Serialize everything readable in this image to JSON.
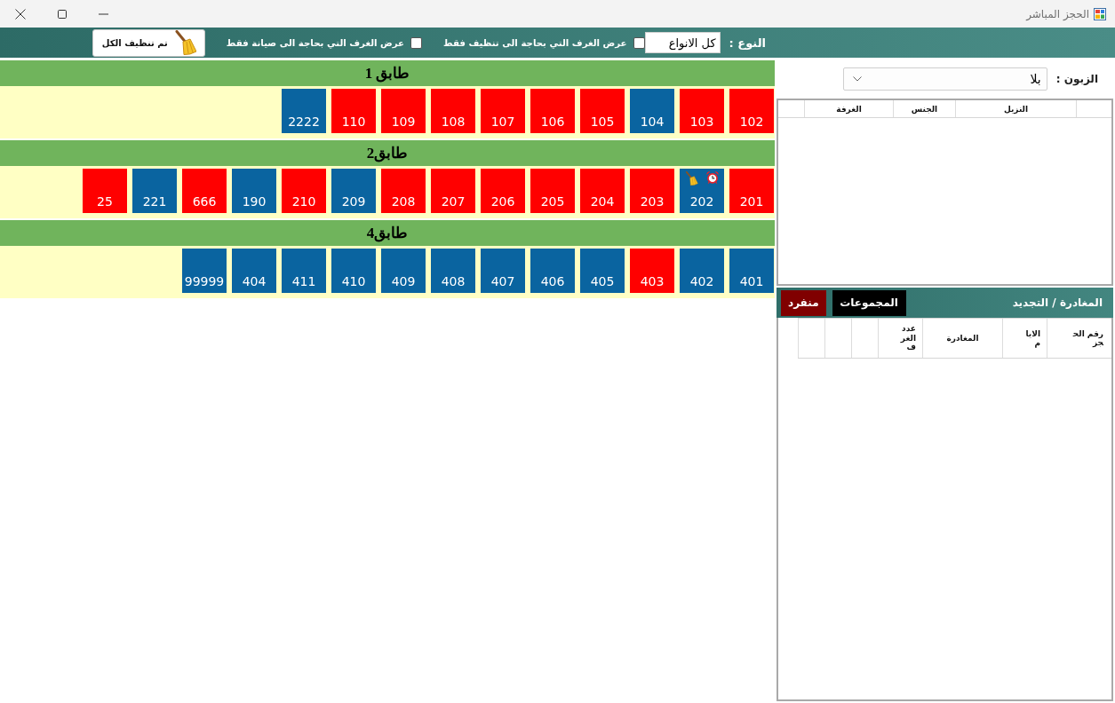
{
  "window": {
    "title": "الحجز المباشر"
  },
  "toolbar": {
    "type_label": "النوع :",
    "type_select": {
      "value": "كل الانواع"
    },
    "filters": [
      {
        "label": "عرض الغرف التي بحاجة الى تنظيف فقط",
        "checked": false
      },
      {
        "label": "عرض الغرف التي بحاجة الى صيانة فقط",
        "checked": false
      }
    ],
    "clean_all_button": {
      "label": "تم تنظيف الكل"
    }
  },
  "floors": [
    {
      "title": "طابق 1",
      "rooms": [
        {
          "number": "102",
          "color": "#ff0000",
          "needs_cleaning": false,
          "alarm": false
        },
        {
          "number": "103",
          "color": "#ff0000",
          "needs_cleaning": false,
          "alarm": false
        },
        {
          "number": "104",
          "color": "#0a64a0",
          "needs_cleaning": false,
          "alarm": false
        },
        {
          "number": "105",
          "color": "#ff0000",
          "needs_cleaning": false,
          "alarm": false
        },
        {
          "number": "106",
          "color": "#ff0000",
          "needs_cleaning": false,
          "alarm": false
        },
        {
          "number": "107",
          "color": "#ff0000",
          "needs_cleaning": false,
          "alarm": false
        },
        {
          "number": "108",
          "color": "#ff0000",
          "needs_cleaning": false,
          "alarm": false
        },
        {
          "number": "109",
          "color": "#ff0000",
          "needs_cleaning": false,
          "alarm": false
        },
        {
          "number": "110",
          "color": "#ff0000",
          "needs_cleaning": false,
          "alarm": false
        },
        {
          "number": "2222",
          "color": "#0a64a0",
          "needs_cleaning": false,
          "alarm": false
        }
      ]
    },
    {
      "title": "طابق2",
      "rooms": [
        {
          "number": "201",
          "color": "#ff0000",
          "needs_cleaning": false,
          "alarm": false
        },
        {
          "number": "202",
          "color": "#0a64a0",
          "needs_cleaning": true,
          "alarm": true
        },
        {
          "number": "203",
          "color": "#ff0000",
          "needs_cleaning": false,
          "alarm": false
        },
        {
          "number": "204",
          "color": "#ff0000",
          "needs_cleaning": false,
          "alarm": false
        },
        {
          "number": "205",
          "color": "#ff0000",
          "needs_cleaning": false,
          "alarm": false
        },
        {
          "number": "206",
          "color": "#ff0000",
          "needs_cleaning": false,
          "alarm": false
        },
        {
          "number": "207",
          "color": "#ff0000",
          "needs_cleaning": false,
          "alarm": false
        },
        {
          "number": "208",
          "color": "#ff0000",
          "needs_cleaning": false,
          "alarm": false
        },
        {
          "number": "209",
          "color": "#0a64a0",
          "needs_cleaning": false,
          "alarm": false
        },
        {
          "number": "210",
          "color": "#ff0000",
          "needs_cleaning": false,
          "alarm": false
        },
        {
          "number": "190",
          "color": "#0a64a0",
          "needs_cleaning": false,
          "alarm": false
        },
        {
          "number": "666",
          "color": "#ff0000",
          "needs_cleaning": false,
          "alarm": false
        },
        {
          "number": "221",
          "color": "#0a64a0",
          "needs_cleaning": false,
          "alarm": false
        },
        {
          "number": "25",
          "color": "#ff0000",
          "needs_cleaning": false,
          "alarm": false
        }
      ]
    },
    {
      "title": "طابق4",
      "rooms": [
        {
          "number": "401",
          "color": "#0a64a0",
          "needs_cleaning": false,
          "alarm": false
        },
        {
          "number": "402",
          "color": "#0a64a0",
          "needs_cleaning": false,
          "alarm": false
        },
        {
          "number": "403",
          "color": "#ff0000",
          "needs_cleaning": false,
          "alarm": false
        },
        {
          "number": "405",
          "color": "#0a64a0",
          "needs_cleaning": false,
          "alarm": false
        },
        {
          "number": "406",
          "color": "#0a64a0",
          "needs_cleaning": false,
          "alarm": false
        },
        {
          "number": "407",
          "color": "#0a64a0",
          "needs_cleaning": false,
          "alarm": false
        },
        {
          "number": "408",
          "color": "#0a64a0",
          "needs_cleaning": false,
          "alarm": false
        },
        {
          "number": "409",
          "color": "#0a64a0",
          "needs_cleaning": false,
          "alarm": false
        },
        {
          "number": "410",
          "color": "#0a64a0",
          "needs_cleaning": false,
          "alarm": false
        },
        {
          "number": "411",
          "color": "#0a64a0",
          "needs_cleaning": false,
          "alarm": false
        },
        {
          "number": "404",
          "color": "#0a64a0",
          "needs_cleaning": false,
          "alarm": false
        },
        {
          "number": "99999",
          "color": "#0a64a0",
          "needs_cleaning": false,
          "alarm": false
        }
      ]
    }
  ],
  "customer_panel": {
    "label": "الزبون :",
    "select": {
      "value": "بلا"
    },
    "table": {
      "columns": [
        "النزيل",
        "الجنس",
        "الغرفة"
      ]
    }
  },
  "departures_panel": {
    "title": "المغادرة / التجديد",
    "buttons": [
      {
        "label": "المجموعات",
        "color": "#000000"
      },
      {
        "label": "منفرد",
        "color": "#800000"
      }
    ],
    "table": {
      "columns": [
        "رقم الحجز",
        "الايام",
        "المغادرة",
        "عدد الغرف"
      ]
    }
  }
}
